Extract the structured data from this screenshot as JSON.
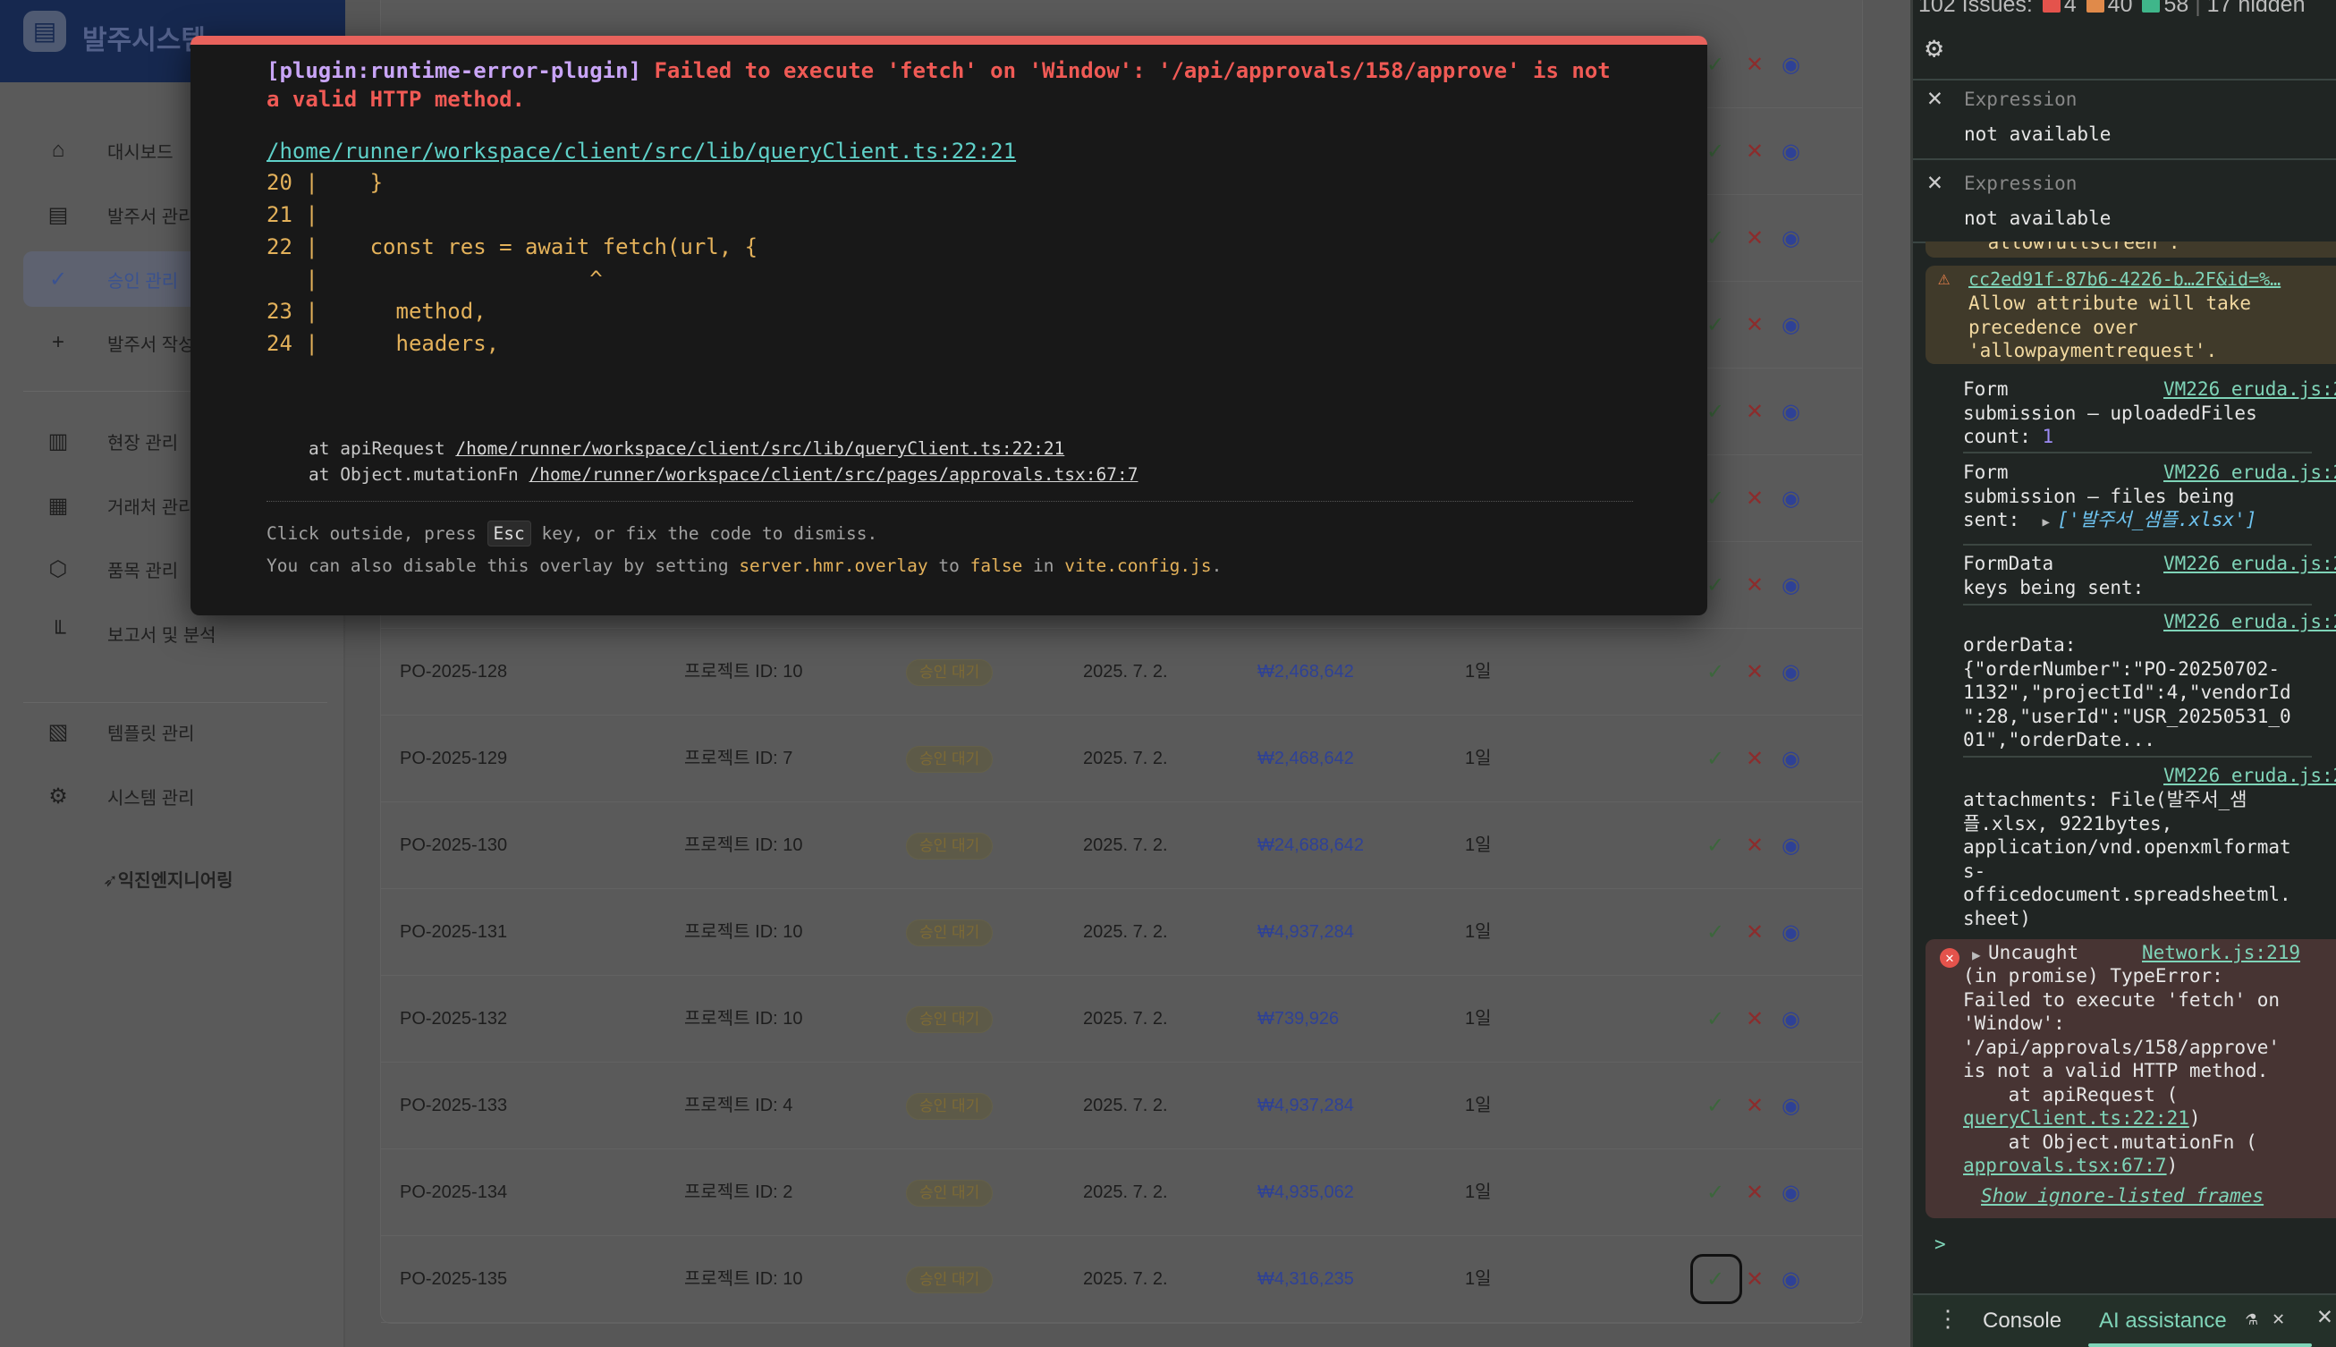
{
  "sidebar": {
    "title": "발주시스템",
    "logo_icon": "clipboard-icon",
    "brand": "익진엔지니어링",
    "items": [
      {
        "label": "대시보드",
        "icon": "home-icon"
      },
      {
        "label": "발주서 관리",
        "icon": "document-icon"
      },
      {
        "label": "승인 관리",
        "icon": "check-circle-icon",
        "active": true
      },
      {
        "label": "발주서 작성",
        "icon": "plus-icon"
      },
      {
        "label": "현장 관리",
        "icon": "building-icon"
      },
      {
        "label": "거래처 관리",
        "icon": "office-icon"
      },
      {
        "label": "품목 관리",
        "icon": "box-icon"
      },
      {
        "label": "보고서 및 분석",
        "icon": "chart-icon"
      },
      {
        "label": "템플릿 관리",
        "icon": "template-icon"
      },
      {
        "label": "시스템 관리",
        "icon": "gear-icon"
      }
    ]
  },
  "table": {
    "rows": [
      {
        "po": "PO-2025-128",
        "project": "프로젝트 ID: 10",
        "status": "승인 대기",
        "date": "2025. 7. 2.",
        "amount": "₩2,468,642",
        "days": "1일"
      },
      {
        "po": "PO-2025-129",
        "project": "프로젝트 ID: 7",
        "status": "승인 대기",
        "date": "2025. 7. 2.",
        "amount": "₩2,468,642",
        "days": "1일"
      },
      {
        "po": "PO-2025-130",
        "project": "프로젝트 ID: 10",
        "status": "승인 대기",
        "date": "2025. 7. 2.",
        "amount": "₩24,688,642",
        "days": "1일"
      },
      {
        "po": "PO-2025-131",
        "project": "프로젝트 ID: 10",
        "status": "승인 대기",
        "date": "2025. 7. 2.",
        "amount": "₩4,937,284",
        "days": "1일"
      },
      {
        "po": "PO-2025-132",
        "project": "프로젝트 ID: 10",
        "status": "승인 대기",
        "date": "2025. 7. 2.",
        "amount": "₩739,926",
        "days": "1일"
      },
      {
        "po": "PO-2025-133",
        "project": "프로젝트 ID: 4",
        "status": "승인 대기",
        "date": "2025. 7. 2.",
        "amount": "₩4,937,284",
        "days": "1일"
      },
      {
        "po": "PO-2025-134",
        "project": "프로젝트 ID: 2",
        "status": "승인 대기",
        "date": "2025. 7. 2.",
        "amount": "₩4,935,062",
        "days": "1일"
      },
      {
        "po": "PO-2025-135",
        "project": "프로젝트 ID: 10",
        "status": "승인 대기",
        "date": "2025. 7. 2.",
        "amount": "₩4,316,235",
        "days": "1일"
      }
    ]
  },
  "overlay": {
    "plugin": "[plugin:runtime-error-plugin]",
    "message1": " Failed to execute 'fetch' on 'Window': '/api/approvals/158/approve' is not",
    "message2": "a valid HTTP method.",
    "file": "/home/runner/workspace/client/src/lib/queryClient.ts:22:21",
    "code": [
      "20 |    }",
      "21 |",
      "22 |    const res = await fetch(url, {",
      "   |                     ^",
      "23 |      method,",
      "24 |      headers,"
    ],
    "stack": [
      {
        "fn": "at apiRequest ",
        "loc": "/home/runner/workspace/client/src/lib/queryClient.ts:22:21"
      },
      {
        "fn": "at Object.mutationFn ",
        "loc": "/home/runner/workspace/client/src/pages/approvals.tsx:67:7"
      }
    ],
    "footer1a": "Click outside, press ",
    "esc": "Esc",
    "footer1b": " key, or fix the code to dismiss.",
    "footer2a": "You can also disable this overlay by setting ",
    "f_code1": "server.hmr.overlay",
    "f_to": " to ",
    "f_code2": "false",
    "f_in": " in ",
    "f_code3": "vite.config.js",
    "f_end": "."
  },
  "devtools": {
    "issues_label": "102 Issues:",
    "errors": "4",
    "warnings": "40",
    "infos": "58",
    "hidden": "17 hidden",
    "expressions": [
      {
        "label": "Expression",
        "value": "not available"
      },
      {
        "label": "Expression",
        "value": "not available"
      }
    ],
    "prev_warning_tail": "'allowfullscreen'.",
    "warning_link": "cc2ed91f-87b6-4226-b…2F&id=%…",
    "warning_text": "Allow attribute will take\nprecedence over\n'allowpaymentrequest'.",
    "logs": [
      {
        "src": "VM226 eruda.js:2",
        "text": "Form\nsubmission – uploadedFiles\ncount: ",
        "num": "1"
      },
      {
        "src": "VM226 eruda.js:2",
        "text": "Form\nsubmission – files being\nsent:  ",
        "arr": "['발주서_샘플.xlsx']"
      },
      {
        "src": "VM226 eruda.js:2",
        "text": "FormData\nkeys being sent:"
      },
      {
        "src": "VM226 eruda.js:2",
        "text": "orderData:\n{\"orderNumber\":\"PO-20250702-\n1132\",\"projectId\":4,\"vendorId\n\":28,\"userId\":\"USR_20250531_0\n01\",\"orderDate..."
      },
      {
        "src": "VM226 eruda.js:2",
        "text": "attachments: File(발주서_샘\n플.xlsx, 9221bytes,\napplication/vnd.openxmlformat\ns-\nofficedocument.spreadsheetml.\nsheet)"
      }
    ],
    "error": {
      "head": "Uncaught",
      "src": "Network.js:219",
      "text": "(in promise) TypeError:\nFailed to execute 'fetch' on\n'Window':\n'/api/approvals/158/approve'\nis not a valid HTTP method.\n    at apiRequest (",
      "link1": "queryClient.ts:22:21",
      "mid": "    at Object.mutationFn (",
      "link2": "approvals.tsx:67:7",
      "show": "Show ignore-listed frames"
    },
    "prompt": ">",
    "tabs": {
      "console": "Console",
      "ai": "AI assistance"
    }
  }
}
